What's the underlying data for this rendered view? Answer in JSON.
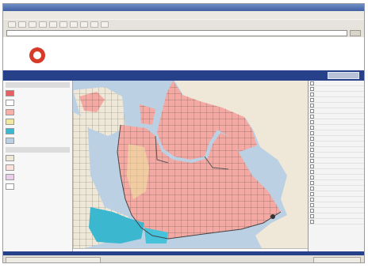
{
  "window": {
    "title": ""
  },
  "menu": {
    "items": [
      "",
      "",
      "",
      "",
      "",
      ""
    ]
  },
  "address": {
    "url": "",
    "go_label": ""
  },
  "site": {
    "title": "",
    "nav_button": ""
  },
  "legend": {
    "header_1": "",
    "header_2": "",
    "items": [
      {
        "label": "",
        "color": "#e56060"
      },
      {
        "label": "",
        "color": "#ffffff"
      },
      {
        "label": "",
        "color": "#f7b0a8"
      },
      {
        "label": "",
        "color": "#f0e7a0"
      },
      {
        "label": "",
        "color": "#3bb8d0"
      },
      {
        "label": "",
        "color": "#bcd0e4"
      },
      {
        "label": "",
        "color": "#efe8d8"
      },
      {
        "label": "",
        "color": "#fbe2dd"
      },
      {
        "label": "",
        "color": "#e9d0e8"
      },
      {
        "label": "",
        "color": "#ffffff"
      }
    ]
  },
  "right_list": {
    "rows": [
      "",
      "",
      "",
      "",
      "",
      "",
      "",
      "",
      "",
      "",
      "",
      "",
      "",
      "",
      "",
      "",
      "",
      "",
      "",
      "",
      "",
      "",
      "",
      "",
      "",
      ""
    ]
  },
  "status": {
    "left": "",
    "right": ""
  },
  "colors": {
    "frame": "#27408a",
    "parcel": "#f5a9a2",
    "water": "#bcd0e4",
    "accent": "#b84040"
  }
}
